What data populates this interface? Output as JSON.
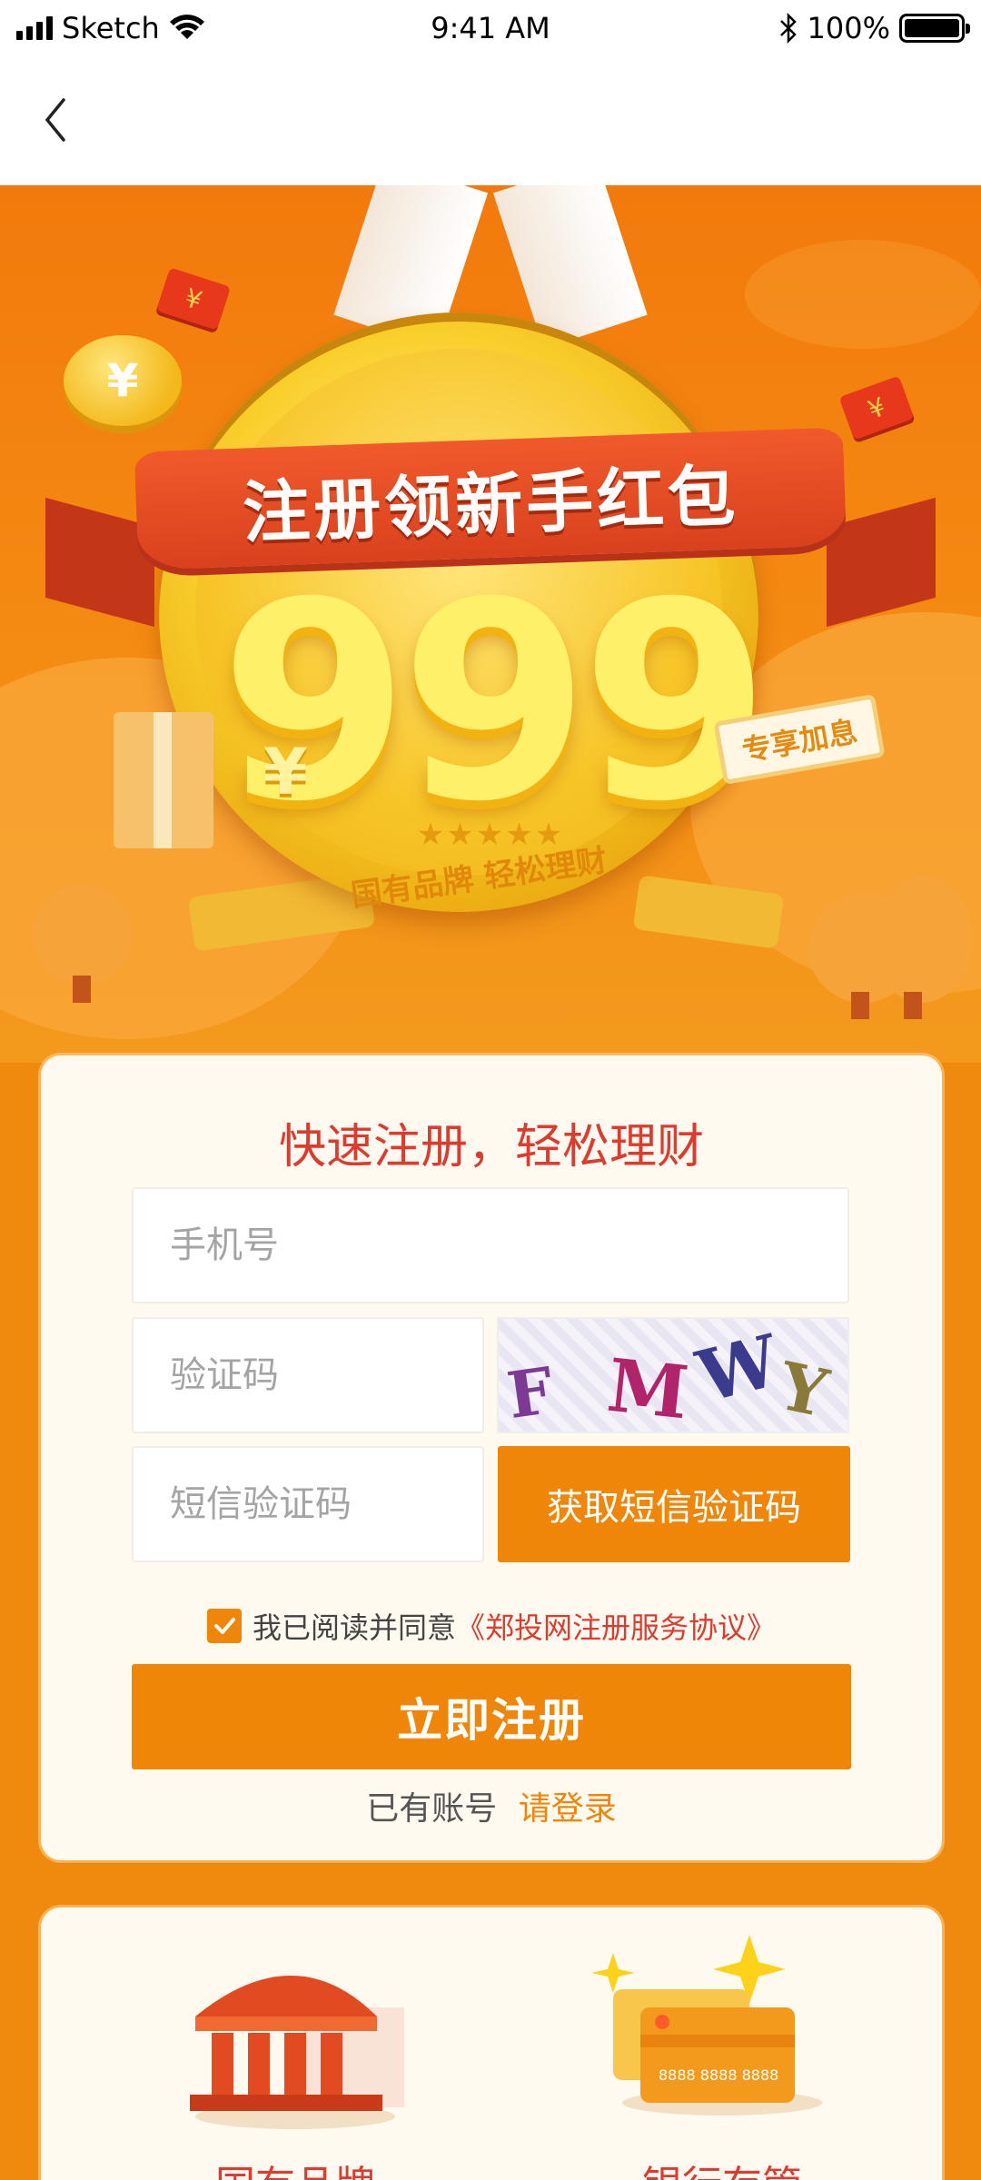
{
  "status_bar": {
    "carrier": "Sketch",
    "time": "9:41 AM",
    "battery": "100%"
  },
  "hero": {
    "banner_title": "注册领新手红包",
    "amount": "999",
    "currency_symbol": "¥",
    "stars": "★★★★★",
    "slogan": "国有品牌 轻松理财",
    "tag": "专享加息",
    "coin_symbol": "¥",
    "envelope_symbol": "¥"
  },
  "form": {
    "title": "快速注册，轻松理财",
    "phone_placeholder": "手机号",
    "captcha_placeholder": "验证码",
    "captcha_text": "FMWY",
    "sms_placeholder": "短信验证码",
    "sms_button": "获取短信验证码",
    "agree_text": "我已阅读并同意",
    "agree_link": "《郑投网注册服务协议》",
    "agree_checked": true,
    "submit": "立即注册",
    "login_prompt": "已有账号",
    "login_link": "请登录"
  },
  "features": [
    {
      "label": "国有品牌",
      "icon": "bank-building-icon"
    },
    {
      "label": "银行存管",
      "icon": "bank-card-icon"
    }
  ],
  "colors": {
    "primary": "#ef8608",
    "accent_red": "#dc3b2f",
    "background": "#f08a0e"
  }
}
